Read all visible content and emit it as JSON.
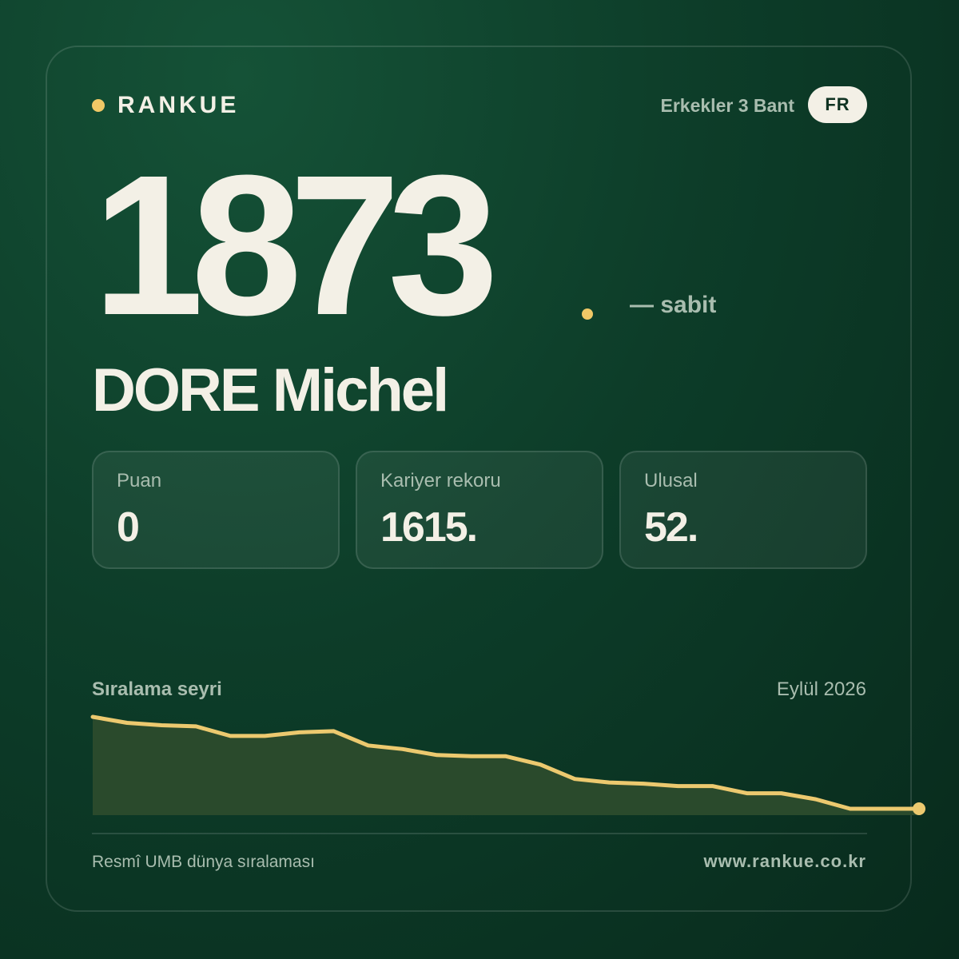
{
  "brand": {
    "name": "RANKUE"
  },
  "header": {
    "category": "Erkekler 3 Bant",
    "country": "FR"
  },
  "hero": {
    "rank": "1873",
    "trend": "— sabit"
  },
  "player": {
    "name": "DORE Michel"
  },
  "stats": [
    {
      "label": "Puan",
      "value": "0"
    },
    {
      "label": "Kariyer rekoru",
      "value": "1615."
    },
    {
      "label": "Ulusal",
      "value": "52."
    }
  ],
  "chart_section": {
    "title": "Sıralama seyri",
    "date": "Eylül 2026"
  },
  "chart_data": {
    "type": "area",
    "x": [
      1,
      2,
      3,
      4,
      5,
      6,
      7,
      8,
      9,
      10,
      11,
      12,
      13,
      14,
      15,
      16,
      17,
      18,
      19,
      20,
      21,
      22,
      23,
      24,
      25
    ],
    "series": [
      {
        "values": [
          1615,
          1640,
          1650,
          1655,
          1695,
          1695,
          1680,
          1675,
          1735,
          1750,
          1775,
          1780,
          1780,
          1815,
          1875,
          1890,
          1895,
          1905,
          1905,
          1935,
          1935,
          1960,
          2000,
          2000,
          2000
        ]
      }
    ],
    "y_inverted": true,
    "line_color": "#ecc96f",
    "fill_color": "#2a4a2c",
    "grid": false,
    "legend": "none"
  },
  "footer": {
    "source": "Resmî UMB dünya sıralaması",
    "url": "www.rankue.co.kr"
  },
  "colors": {
    "accent": "#f0c866",
    "text": "#f3f0e6",
    "muted": "#a9bdaf",
    "background": "#0d3d29"
  }
}
